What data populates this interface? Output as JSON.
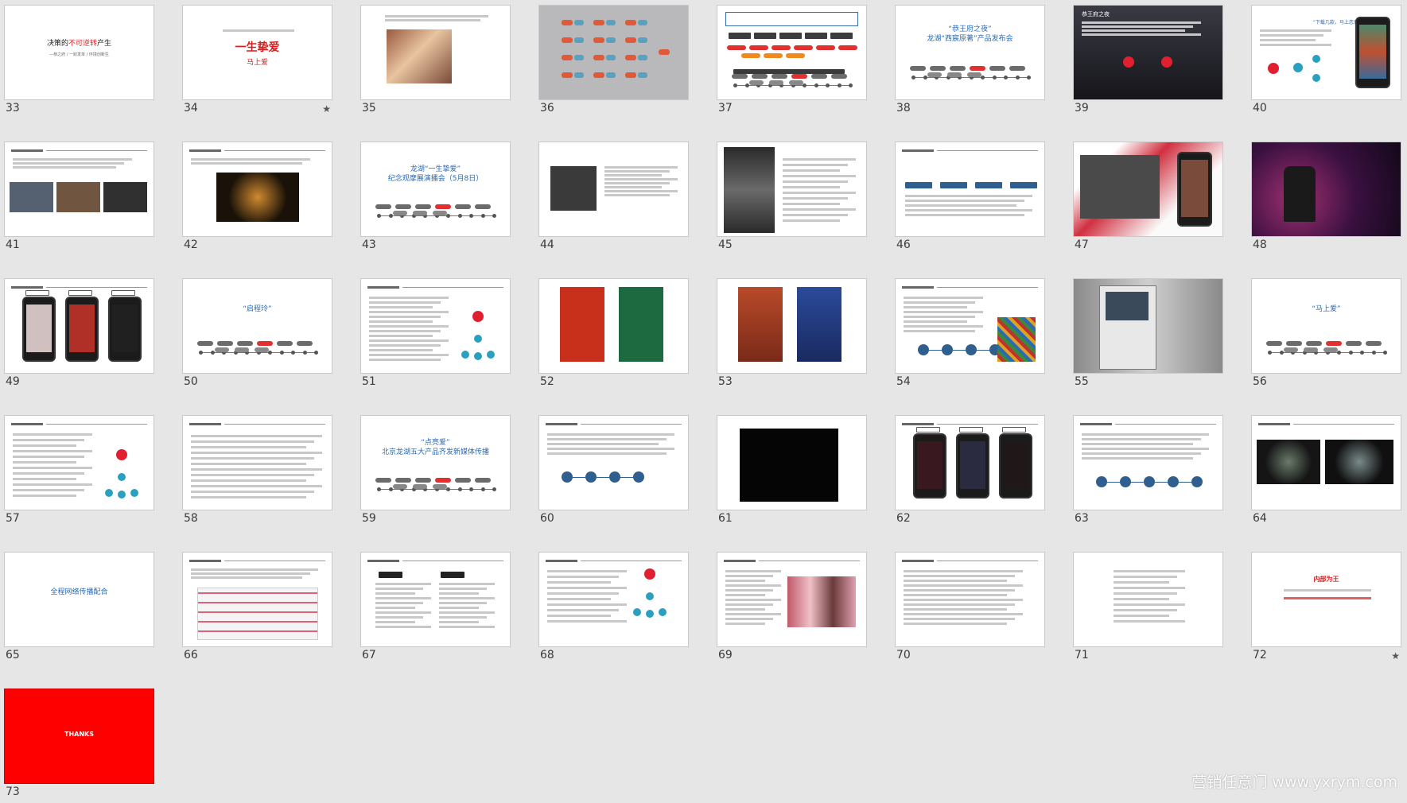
{
  "slides": [
    {
      "num": "33",
      "star": false,
      "title_pre": "决策的",
      "title_red": "不可逆转",
      "title_post": "产生",
      "subtitle": "—恭之府 / 一财发单 / 环境创新生"
    },
    {
      "num": "34",
      "star": true,
      "text": "一生挚爱",
      "sub": "马上爱"
    },
    {
      "num": "35",
      "star": false
    },
    {
      "num": "36",
      "star": false
    },
    {
      "num": "37",
      "star": false
    },
    {
      "num": "38",
      "star": false,
      "title": "“恭王府之夜”",
      "subtitle": "龙湖“西宸原著”产品发布会"
    },
    {
      "num": "39",
      "star": false,
      "title": "恭王府之夜"
    },
    {
      "num": "40",
      "star": false,
      "title": "“下载几款，马上恋爱”"
    },
    {
      "num": "41",
      "star": false
    },
    {
      "num": "42",
      "star": false
    },
    {
      "num": "43",
      "star": false,
      "title": "龙湖“一生挚爱”",
      "subtitle": "纪念观摩展演播会（5月8日）"
    },
    {
      "num": "44",
      "star": false
    },
    {
      "num": "45",
      "star": false
    },
    {
      "num": "46",
      "star": false
    },
    {
      "num": "47",
      "star": false
    },
    {
      "num": "48",
      "star": false
    },
    {
      "num": "49",
      "star": false
    },
    {
      "num": "50",
      "star": false,
      "title": "“启程玲”"
    },
    {
      "num": "51",
      "star": false
    },
    {
      "num": "52",
      "star": false
    },
    {
      "num": "53",
      "star": false
    },
    {
      "num": "54",
      "star": false
    },
    {
      "num": "55",
      "star": false
    },
    {
      "num": "56",
      "star": false,
      "title": "“马上爱”"
    },
    {
      "num": "57",
      "star": false
    },
    {
      "num": "58",
      "star": false
    },
    {
      "num": "59",
      "star": false,
      "title": "“点亮爱”",
      "subtitle": "北京龙湖五大产品齐发新媒体传播"
    },
    {
      "num": "60",
      "star": false
    },
    {
      "num": "61",
      "star": false
    },
    {
      "num": "62",
      "star": false
    },
    {
      "num": "63",
      "star": false
    },
    {
      "num": "64",
      "star": false
    },
    {
      "num": "65",
      "star": false,
      "title": "全程网络传播配合"
    },
    {
      "num": "66",
      "star": false
    },
    {
      "num": "67",
      "star": false
    },
    {
      "num": "68",
      "star": false
    },
    {
      "num": "69",
      "star": false
    },
    {
      "num": "70",
      "star": false
    },
    {
      "num": "71",
      "star": false
    },
    {
      "num": "72",
      "star": true,
      "title": "内部为王"
    },
    {
      "num": "73",
      "star": false,
      "text": "THANKS"
    }
  ],
  "star_glyph": "★",
  "watermark": "营销任意门 www.yxrym.com",
  "colors": {
    "background": "#e6e6e6",
    "accent_red": "#e02020",
    "accent_blue": "#2a6ab3",
    "thanks_red": "#ff0000"
  }
}
